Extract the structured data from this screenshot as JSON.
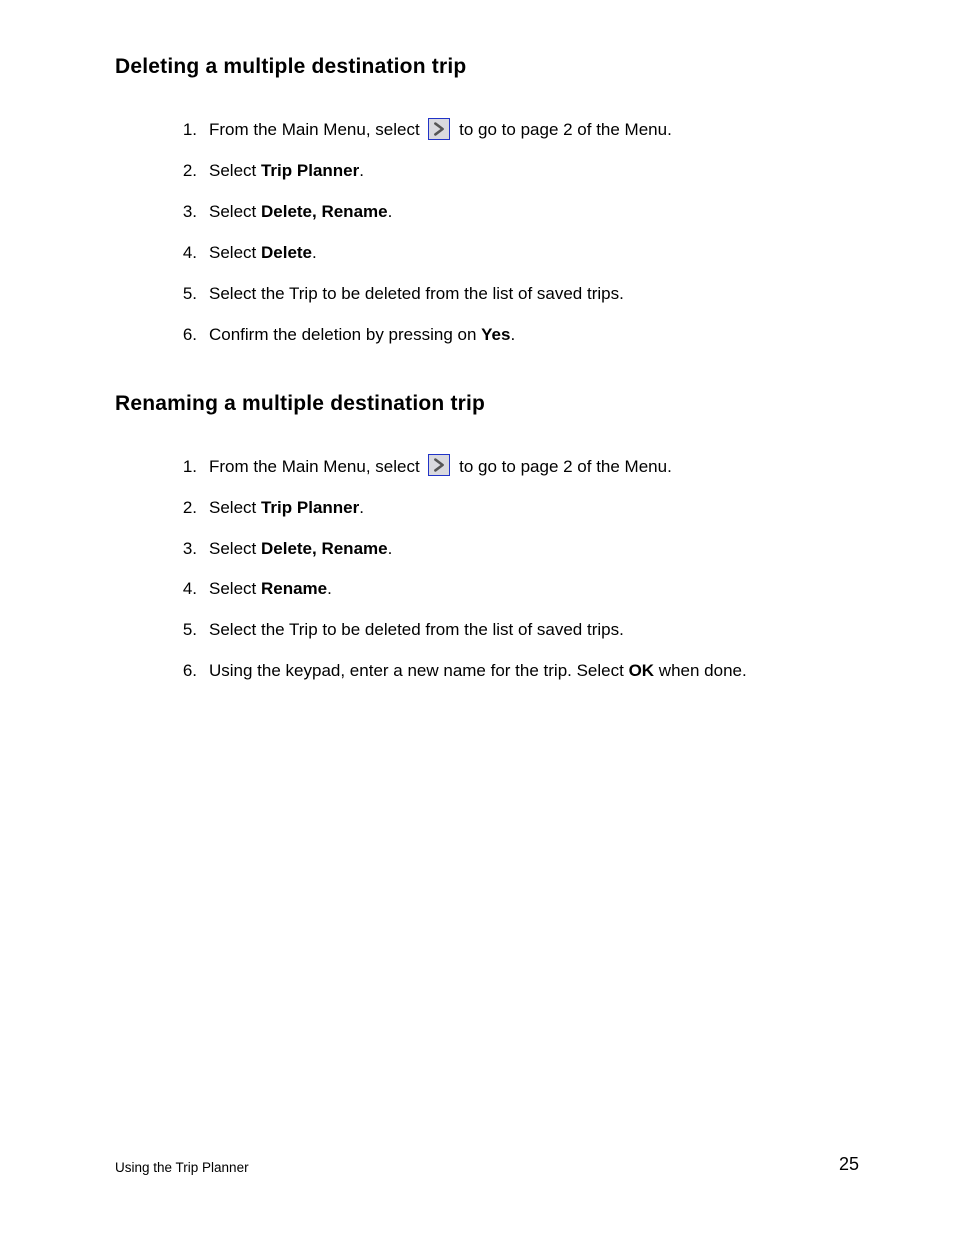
{
  "sections": [
    {
      "heading": "Deleting a multiple destination trip",
      "steps": [
        {
          "num": "1.",
          "pre": "From the Main Menu, select ",
          "icon": "next-page-icon",
          "post": " to go to page 2 of the Menu."
        },
        {
          "num": "2.",
          "pre": "Select ",
          "bold": "Trip Planner",
          "post": "."
        },
        {
          "num": "3.",
          "pre": "Select ",
          "bold": "Delete, Rename",
          "post": "."
        },
        {
          "num": "4.",
          "pre": "Select ",
          "bold": "Delete",
          "post": "."
        },
        {
          "num": "5.",
          "pre": "Select the Trip to be deleted from the list of saved trips."
        },
        {
          "num": "6.",
          "pre": "Confirm the deletion by pressing on ",
          "bold": "Yes",
          "post": "."
        }
      ]
    },
    {
      "heading": "Renaming a multiple destination trip",
      "steps": [
        {
          "num": "1.",
          "pre": "From the Main Menu, select ",
          "icon": "next-page-icon",
          "post": " to go to page 2 of the Menu."
        },
        {
          "num": "2.",
          "pre": "Select ",
          "bold": "Trip Planner",
          "post": "."
        },
        {
          "num": "3.",
          "pre": "Select ",
          "bold": "Delete, Rename",
          "post": "."
        },
        {
          "num": "4.",
          "pre": "Select ",
          "bold": "Rename",
          "post": "."
        },
        {
          "num": "5.",
          "pre": "Select the Trip to be deleted from the list of saved trips."
        },
        {
          "num": "6.",
          "pre": "Using the keypad, enter a new name for the trip. Select ",
          "bold": "OK",
          "post": " when done."
        }
      ]
    }
  ],
  "footer": {
    "left": "Using the Trip Planner",
    "right": "25"
  }
}
